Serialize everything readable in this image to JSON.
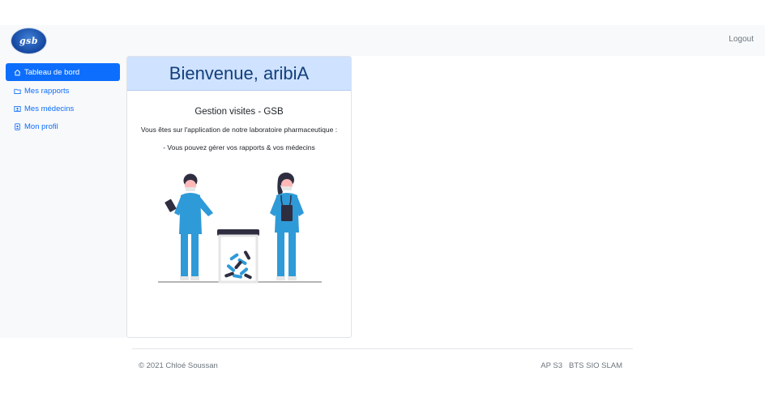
{
  "header": {
    "logo_text": "gsb",
    "logout_label": "Logout"
  },
  "sidebar": {
    "items": [
      {
        "label": "Tableau de bord",
        "icon": "house-icon",
        "active": true
      },
      {
        "label": "Mes rapports",
        "icon": "folder-icon",
        "active": false
      },
      {
        "label": "Mes médecins",
        "icon": "person-card-icon",
        "active": false
      },
      {
        "label": "Mon profil",
        "icon": "person-badge-icon",
        "active": false
      }
    ]
  },
  "main": {
    "welcome_title": "Bienvenue, aribiA",
    "subtitle": "Gestion visites - GSB",
    "line1": "Vous êtes sur l'application de notre laboratoire pharmaceutique :",
    "line2": "- Vous pouvez gérer vos rapports & vos médecins"
  },
  "footer": {
    "copyright": "© 2021 Chloé Soussan",
    "link1": "AP S3",
    "link2": "BTS SIO SLAM"
  },
  "colors": {
    "primary": "#0d6efd",
    "card_header_bg": "#cfe2ff",
    "illustration_blue": "#2f9ad8"
  }
}
